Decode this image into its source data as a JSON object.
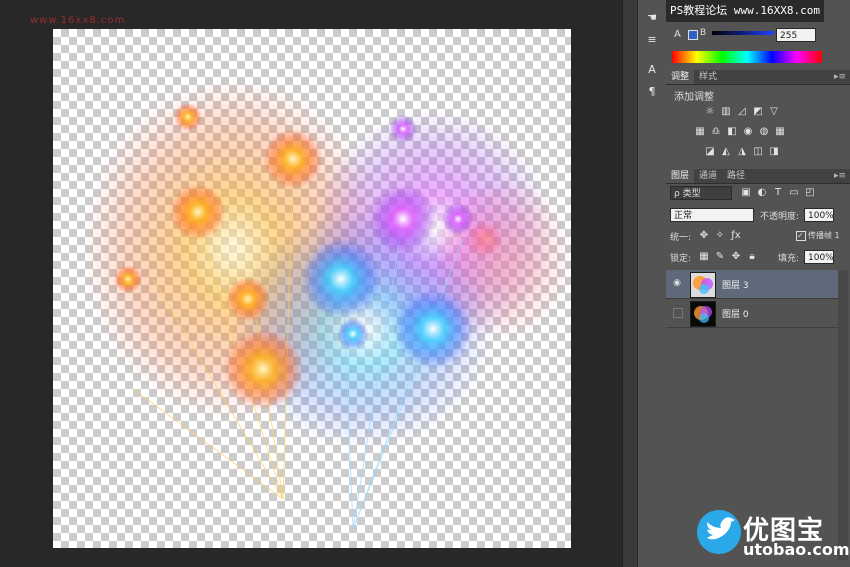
{
  "watermark": {
    "top_left": "www.16xx8.com",
    "url": "PS教程论坛 www.16XX8.com",
    "brand_cn": "优图宝",
    "brand_en": "utobao.com"
  },
  "color_panel": {
    "label_a": "A",
    "label_b": "B",
    "value": "255"
  },
  "adjust_panel": {
    "tabs": [
      "调整",
      "样式"
    ],
    "title": "添加调整"
  },
  "layers_panel": {
    "tabs": [
      "图层",
      "通道",
      "路径"
    ],
    "filter_kind": "ρ 类型",
    "blend_mode": "正常",
    "opacity_label": "不透明度:",
    "opacity_value": "100%",
    "unify_label": "统一:",
    "propagate_label": "传播帧 1",
    "lock_label": "锁定:",
    "fill_label": "填充:",
    "fill_value": "100%",
    "layers": [
      {
        "name": "图层 3",
        "selected": true,
        "visible": true
      },
      {
        "name": "图层 0",
        "selected": false,
        "visible": false
      }
    ]
  },
  "colors": {
    "accent": "#5e6a7a",
    "panel": "#535353",
    "canvas_bg": "#282828"
  }
}
